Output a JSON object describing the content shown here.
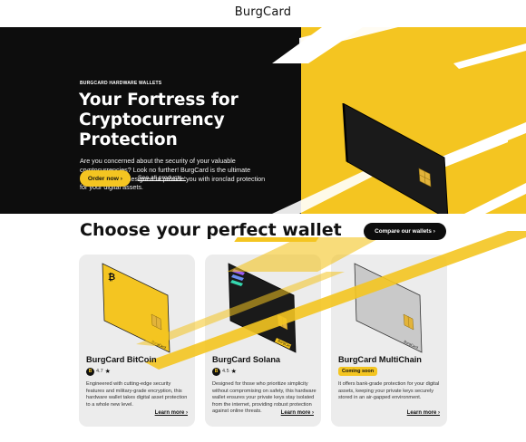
{
  "brand": {
    "name": "BurgCard"
  },
  "hero": {
    "eyebrow": "BURGCARD HARDWARE WALLETS",
    "title": "Your Fortress for Cryptocurrency Protection",
    "description": "Are you concerned about the security of your valuable cryptocurrencies? Look no further! BurgCard is the ultimate hardware wallet designed to provide you with ironclad protection for your digital assets.",
    "primary_button": "Order now ›",
    "secondary_link": "See all products ›"
  },
  "section": {
    "title": "Choose your perfect wallet",
    "compare_button": "Compare our wallets ›"
  },
  "products": [
    {
      "name": "BurgCard BitCoin",
      "rating": "4.7",
      "rating_coin": "B",
      "star": "★",
      "description": "Engineered with cutting-edge security features and military-grade encryption, this hardware wallet takes digital asset protection to a whole new level.",
      "link": "Learn more ›",
      "card_color": "#f4c521",
      "card_logo": "bitcoin-icon"
    },
    {
      "name": "BurgCard Solana",
      "rating": "4.5",
      "rating_coin": "B",
      "star": "★",
      "description": "Designed for those who prioritize simplicity without compromising on safety, this hardware wallet ensures your private keys stay isolated from the internet, providing robust protection against online threats.",
      "link": "Learn more ›",
      "card_color": "#1a1a1a",
      "card_logo": "solana-icon"
    },
    {
      "name": "BurgCard MultiChain",
      "badge": "Coming soon",
      "description": "It offers bank-grade protection for your digital assets, keeping your private keys securely stored in an air-gapped environment.",
      "link": "Learn more ›",
      "card_color": "#c9c9c9",
      "card_logo": ""
    }
  ],
  "card_label": "BurgCard",
  "colors": {
    "accent": "#f4c521",
    "dark": "#0d0d0d",
    "card_bg": "#ececec"
  }
}
